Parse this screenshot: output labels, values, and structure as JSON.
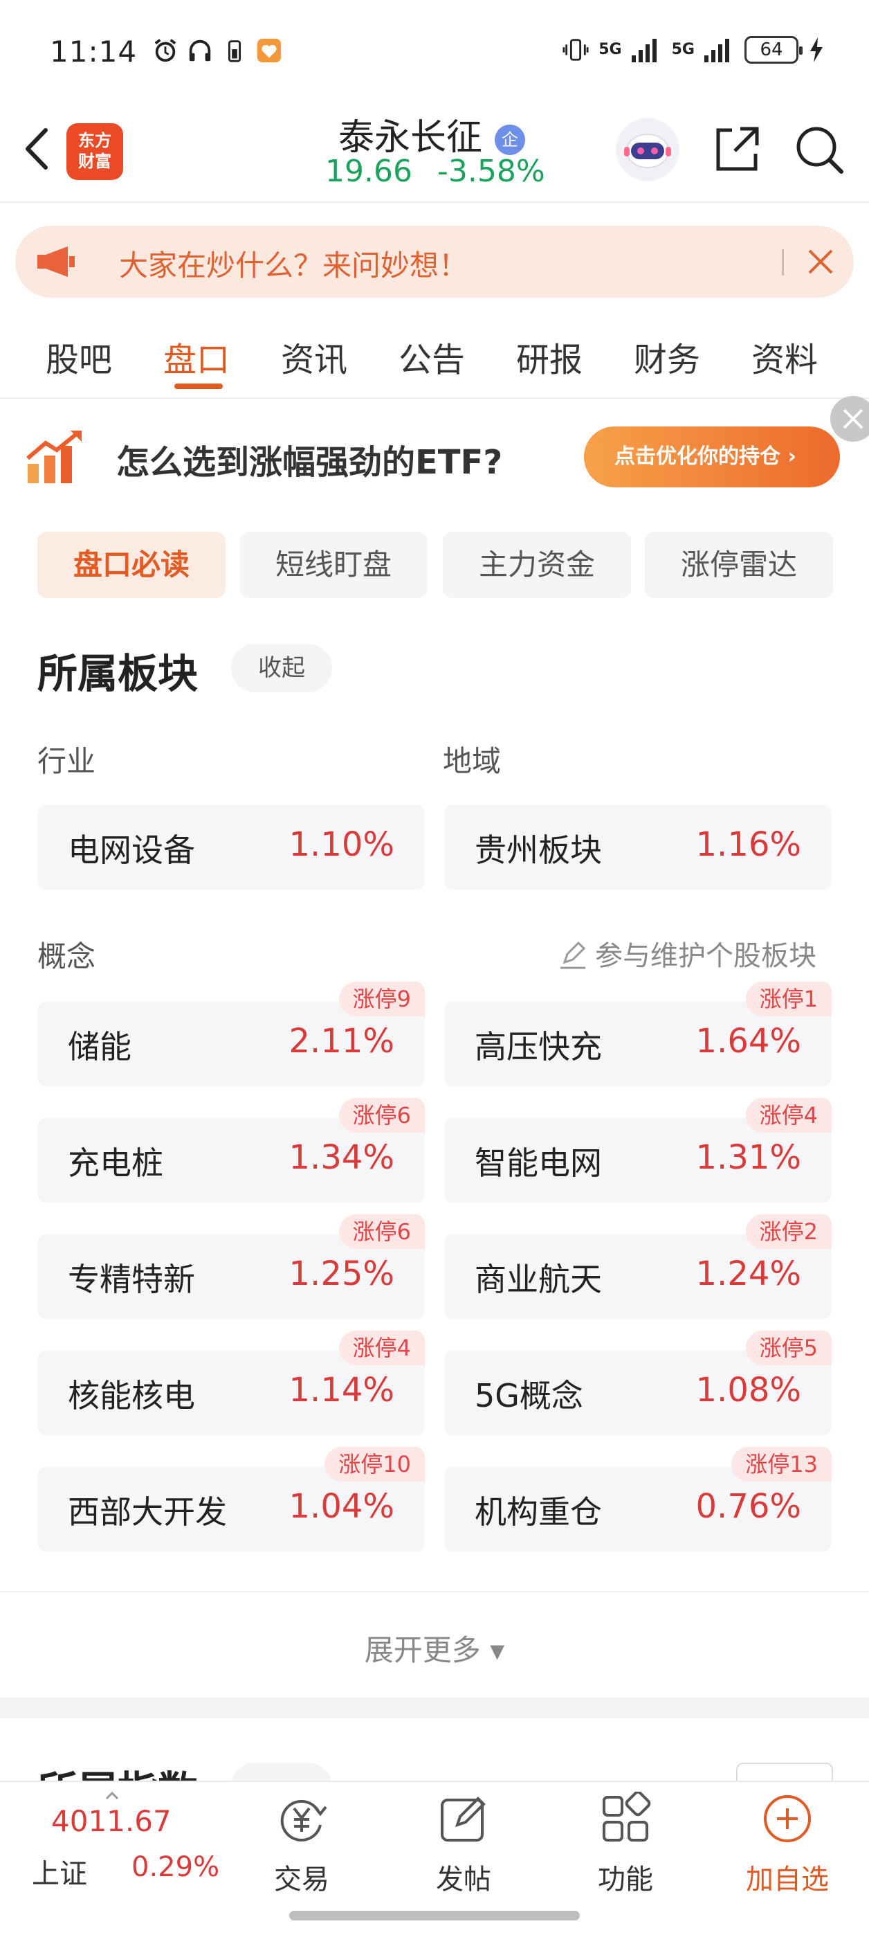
{
  "status_bar": {
    "time": "11:14",
    "network_1": "5G",
    "network_2": "5G",
    "battery": "64",
    "icons": [
      "alarm-icon",
      "headphones-icon",
      "battery-small-icon",
      "heart-app-icon",
      "vibrate-icon",
      "charging-icon"
    ]
  },
  "header": {
    "logo_line1": "东方",
    "logo_line2": "财富",
    "stock_name": "泰永长征",
    "badge": "企",
    "price": "19.66",
    "change_pct": "-3.58%"
  },
  "notice": {
    "text": "大家在炒什么？来问妙想！"
  },
  "tabs": [
    "股吧",
    "盘口",
    "资讯",
    "公告",
    "研报",
    "财务",
    "资料"
  ],
  "active_tab": "盘口",
  "etf_banner": {
    "text": "怎么选到涨幅强劲的ETF?",
    "button": "点击优化你的持仓 ›"
  },
  "chips": [
    "盘口必读",
    "短线盯盘",
    "主力资金",
    "涨停雷达"
  ],
  "section": {
    "title": "所属板块",
    "collapse": "收起",
    "industry_label": "行业",
    "region_label": "地域",
    "industry": {
      "name": "电网设备",
      "pct": "1.10%"
    },
    "region": {
      "name": "贵州板块",
      "pct": "1.16%"
    },
    "concept_label": "概念",
    "maintain_link": "参与维护个股板块",
    "concepts": [
      {
        "name": "储能",
        "pct": "2.11%",
        "badge": "涨停9"
      },
      {
        "name": "高压快充",
        "pct": "1.64%",
        "badge": "涨停1"
      },
      {
        "name": "充电桩",
        "pct": "1.34%",
        "badge": "涨停6"
      },
      {
        "name": "智能电网",
        "pct": "1.31%",
        "badge": "涨停4"
      },
      {
        "name": "专精特新",
        "pct": "1.25%",
        "badge": "涨停6"
      },
      {
        "name": "商业航天",
        "pct": "1.24%",
        "badge": "涨停2"
      },
      {
        "name": "核能核电",
        "pct": "1.14%",
        "badge": "涨停4"
      },
      {
        "name": "5G概念",
        "pct": "1.08%",
        "badge": "涨停5"
      },
      {
        "name": "西部大开发",
        "pct": "1.04%",
        "badge": "涨停10"
      },
      {
        "name": "机构重仓",
        "pct": "0.76%",
        "badge": "涨停13"
      }
    ],
    "expand_more": "展开更多 ▾"
  },
  "next_section": {
    "title": "所属指数"
  },
  "bottom_nav": {
    "index_value": "4011.67",
    "index_name": "上证",
    "index_pct": "0.29%",
    "items": [
      "交易",
      "发帖",
      "功能",
      "加自选"
    ]
  },
  "colors": {
    "accent": "#e05b24",
    "up": "#d93a3a",
    "down": "#1aa35c"
  }
}
